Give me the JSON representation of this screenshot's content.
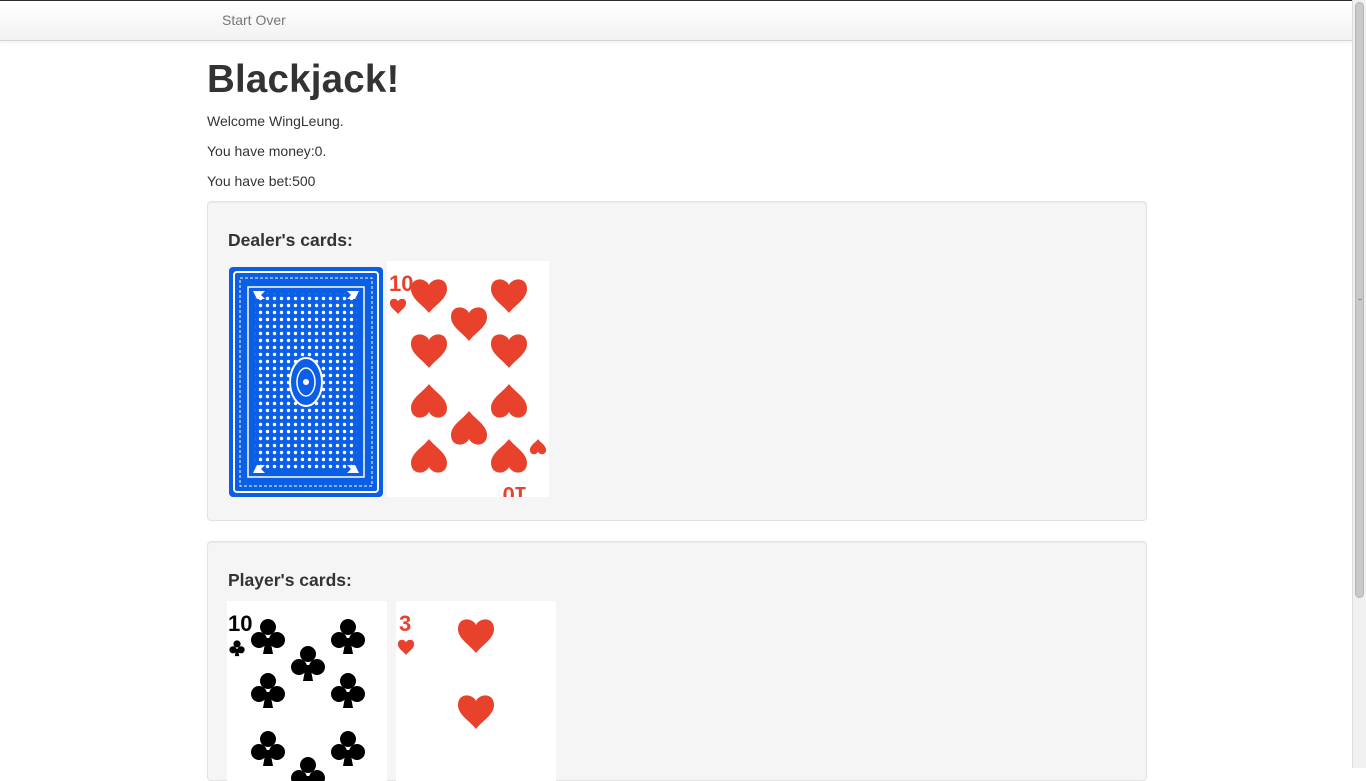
{
  "navbar": {
    "brand_label": "Start Over"
  },
  "page": {
    "title": "Blackjack!",
    "welcome": "Welcome WingLeung.",
    "money": "You have money:0.",
    "bet": "You have bet:500"
  },
  "dealer": {
    "heading": "Dealer's cards:",
    "cards": [
      {
        "face": "back",
        "color": "#0a5fe6"
      },
      {
        "face": "up",
        "rank": "10",
        "suit": "hearts",
        "color": "#e8412c"
      }
    ]
  },
  "player": {
    "heading": "Player's cards:",
    "cards": [
      {
        "face": "up",
        "rank": "10",
        "suit": "clubs",
        "color": "#000000"
      },
      {
        "face": "up",
        "rank": "3",
        "suit": "hearts",
        "color": "#e8412c"
      }
    ]
  }
}
